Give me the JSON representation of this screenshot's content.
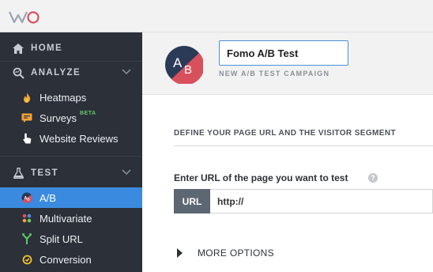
{
  "colors": {
    "sidebar_bg": "#2b3039",
    "active": "#3a8be0",
    "accent_red": "#d9505d",
    "accent_navy": "#2a3a57"
  },
  "sidebar": {
    "home": {
      "label": "HOME",
      "icon": "home-icon"
    },
    "analyze": {
      "label": "ANALYZE",
      "icon": "analyze-icon",
      "items": [
        {
          "label": "Heatmaps",
          "icon": "flame-icon"
        },
        {
          "label": "Surveys",
          "icon": "survey-icon",
          "tag": "BETA"
        },
        {
          "label": "Website Reviews",
          "icon": "pointer-hand-icon"
        }
      ]
    },
    "test": {
      "label": "TEST",
      "icon": "flask-icon",
      "items": [
        {
          "label": "A/B",
          "icon": "ab-icon",
          "active": true
        },
        {
          "label": "Multivariate",
          "icon": "multivariate-icon"
        },
        {
          "label": "Split URL",
          "icon": "split-icon"
        },
        {
          "label": "Conversion",
          "icon": "conversion-icon"
        }
      ]
    }
  },
  "campaign": {
    "badge_text": "AB",
    "name_value": "Fomo A/B Test",
    "subtitle": "NEW A/B TEST CAMPAIGN"
  },
  "form": {
    "section_title": "DEFINE YOUR PAGE URL AND THE VISITOR SEGMENT",
    "url_label": "Enter URL of the page you want to test",
    "help": "?",
    "url_prefix": "URL",
    "url_value": "http://",
    "more_options": "MORE OPTIONS"
  }
}
